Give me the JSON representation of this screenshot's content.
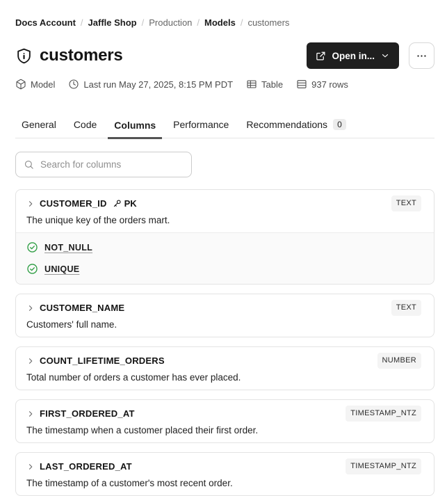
{
  "breadcrumb": {
    "separator": "/",
    "items": [
      {
        "label": "Docs Account",
        "bold": true
      },
      {
        "label": "Jaffle Shop",
        "bold": true
      },
      {
        "label": "Production",
        "bold": false
      },
      {
        "label": "Models",
        "bold": true
      },
      {
        "label": "customers",
        "bold": false
      }
    ]
  },
  "header": {
    "title": "customers",
    "open_in_label": "Open in..."
  },
  "meta": {
    "items": [
      {
        "icon": "cube-icon",
        "label": "Model"
      },
      {
        "icon": "clock-icon",
        "label": "Last run May 27, 2025, 8:15 PM PDT"
      },
      {
        "icon": "table-icon",
        "label": "Table"
      },
      {
        "icon": "rows-icon",
        "label": "937 rows"
      }
    ]
  },
  "tabs": [
    {
      "label": "General"
    },
    {
      "label": "Code"
    },
    {
      "label": "Columns",
      "active": true
    },
    {
      "label": "Performance"
    },
    {
      "label": "Recommendations",
      "badge": "0"
    }
  ],
  "search": {
    "placeholder": "Search for columns"
  },
  "columns": [
    {
      "name": "CUSTOMER_ID",
      "pk": "PK",
      "type": "TEXT",
      "description": "The unique key of the orders mart.",
      "tests": [
        "NOT_NULL",
        "UNIQUE"
      ]
    },
    {
      "name": "CUSTOMER_NAME",
      "type": "TEXT",
      "description": "Customers' full name."
    },
    {
      "name": "COUNT_LIFETIME_ORDERS",
      "type": "NUMBER",
      "description": "Total number of orders a customer has ever placed."
    },
    {
      "name": "FIRST_ORDERED_AT",
      "type": "TIMESTAMP_NTZ",
      "description": "The timestamp when a customer placed their first order."
    },
    {
      "name": "LAST_ORDERED_AT",
      "type": "TIMESTAMP_NTZ",
      "description": "The timestamp of a customer's most recent order."
    }
  ],
  "colors": {
    "test_pass_green": "#2f9e44",
    "button_dark": "#1f1f1f",
    "type_badge_bg": "#f4f4f4",
    "active_tab_underline": "#545454"
  }
}
